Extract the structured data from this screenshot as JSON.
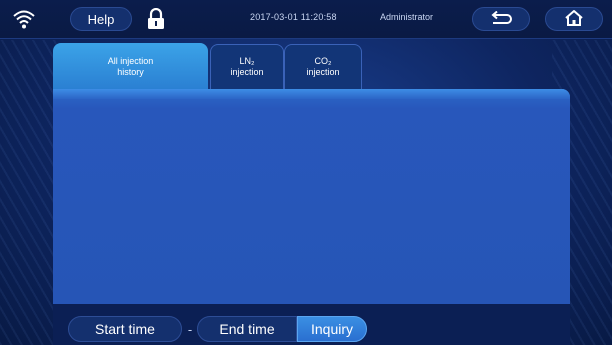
{
  "topbar": {
    "help_label": "Help",
    "datetime": "2017-03-01  11:20:58",
    "user": "Administrator"
  },
  "tabs": [
    {
      "line1": "All injection",
      "line2": "history",
      "active": true
    },
    {
      "line1": "LN₂",
      "line2": "injection",
      "active": false
    },
    {
      "line1": "CO₂",
      "line2": "injection",
      "active": false
    }
  ],
  "filter": {
    "start_label": "Start time",
    "separator": "-",
    "end_label": "End time",
    "inquiry_label": "Inquiry"
  },
  "icons": {
    "wifi": "wifi-icon",
    "lock": "lock-icon",
    "back": "back-arrow-icon",
    "home": "home-icon"
  },
  "colors": {
    "accent": "#2a7fd2",
    "panel": "#2655b6",
    "background": "#0e2560"
  }
}
